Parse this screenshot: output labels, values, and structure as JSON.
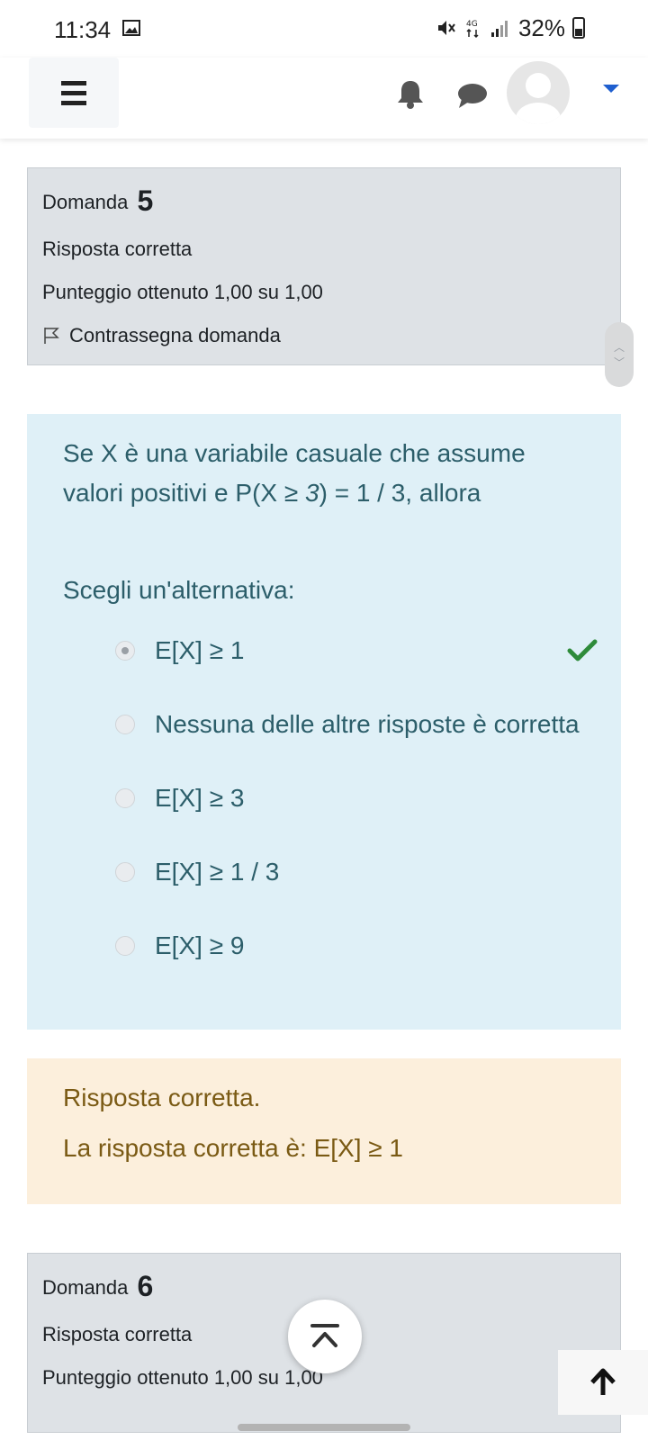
{
  "status_bar": {
    "time": "11:34",
    "battery": "32%"
  },
  "navbar": {
    "menu": "menu",
    "notifications": "notifications",
    "messages": "messages"
  },
  "question5": {
    "label": "Domanda",
    "number": "5",
    "state": "Risposta corretta",
    "score": "Punteggio ottenuto 1,00 su 1,00",
    "flag": "Contrassegna domanda"
  },
  "question": {
    "line1": "Se X è una variabile casuale che assume",
    "line2_pre": "valori positivi e P(X ≥ ",
    "line2_italic": "3",
    "line2_post": ") = 1 / 3, allora",
    "prompt": "Scegli un'alternativa:",
    "options": [
      {
        "label": "E[X] ≥ 1",
        "selected": true,
        "correct": true
      },
      {
        "label": "Nessuna delle altre risposte è corretta",
        "selected": false
      },
      {
        "label": "E[X] ≥ 3",
        "selected": false
      },
      {
        "label": "E[X] ≥ 1 / 3",
        "selected": false
      },
      {
        "label": "E[X] ≥ 9",
        "selected": false
      }
    ]
  },
  "feedback": {
    "result": "Risposta corretta.",
    "correct_answer": "La risposta corretta è: E[X] ≥ 1"
  },
  "question6": {
    "label": "Domanda",
    "number": "6",
    "state": "Risposta corretta",
    "score": "Punteggio ottenuto 1,00 su 1,00"
  },
  "colors": {
    "info_bg": "#dee2e6",
    "question_bg": "#dff0f7",
    "feedback_bg": "#fcefdc",
    "check": "#2e8b3a"
  }
}
